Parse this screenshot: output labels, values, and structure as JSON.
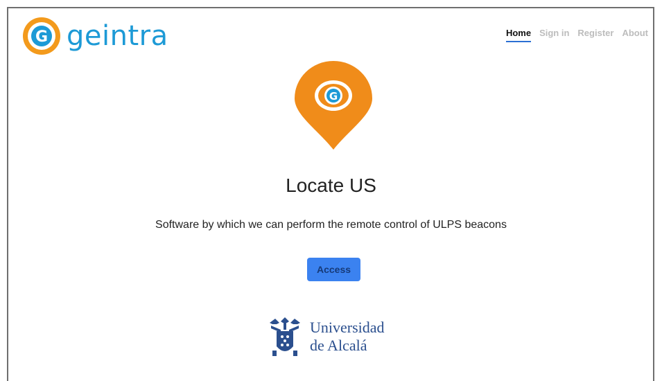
{
  "brand": {
    "name": "geintra",
    "logo_icon": "geintra-g-logo-icon",
    "color": "#1d9ad6",
    "accent": "#f39a1c"
  },
  "nav": {
    "items": [
      {
        "label": "Home",
        "active": true
      },
      {
        "label": "Sign in",
        "active": false
      },
      {
        "label": "Register",
        "active": false
      },
      {
        "label": "About",
        "active": false
      }
    ]
  },
  "hero": {
    "pin_icon": "location-pin-icon",
    "title": "Locate US",
    "subtitle": "Software by which we can perform the remote control of ULPS beacons",
    "access_label": "Access"
  },
  "footer": {
    "university_line1": "Universidad",
    "university_line2": "de Alcalá",
    "crest_icon": "university-crest-icon"
  }
}
